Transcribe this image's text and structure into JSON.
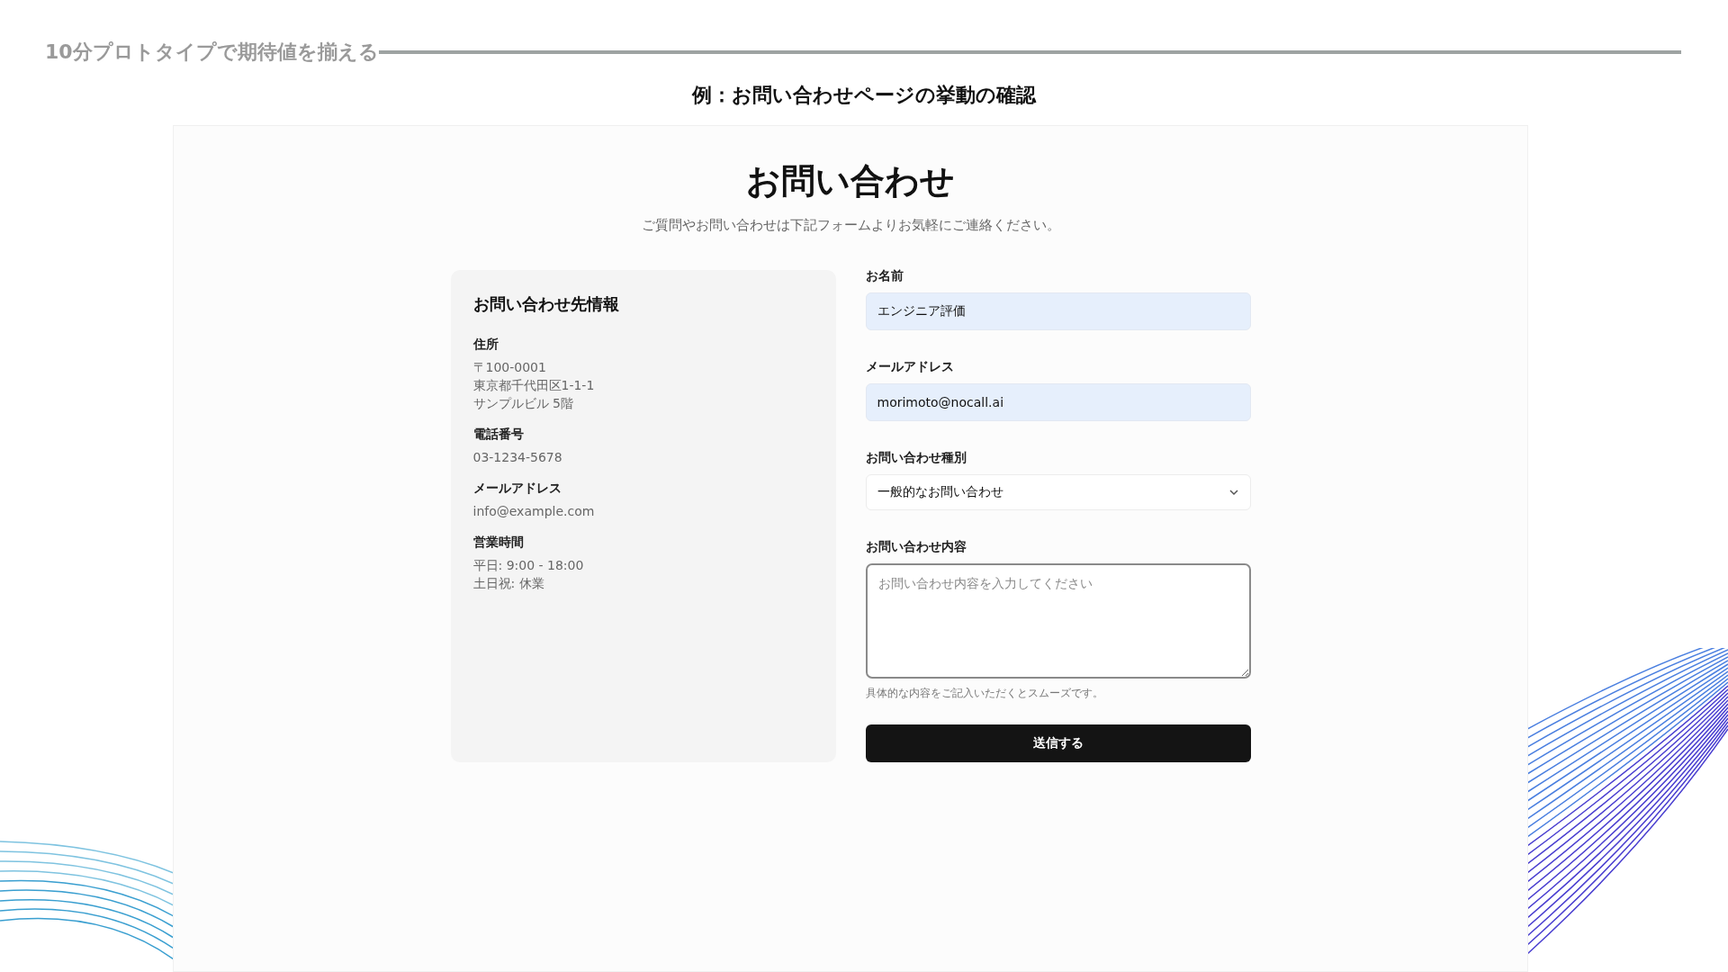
{
  "slide": {
    "heading": "10分プロトタイプで期待値を揃える",
    "caption": "例：お問い合わせページの挙動の確認"
  },
  "page": {
    "title": "お問い合わせ",
    "description": "ご質問やお問い合わせは下記フォームよりお気軽にご連絡ください。",
    "info_card": {
      "title": "お問い合わせ先情報",
      "sections": [
        {
          "label": "住所",
          "lines": [
            "〒100-0001",
            "東京都千代田区1-1-1",
            "サンプルビル 5階"
          ]
        },
        {
          "label": "電話番号",
          "lines": [
            "03-1234-5678"
          ]
        },
        {
          "label": "メールアドレス",
          "lines": [
            "info@example.com"
          ]
        },
        {
          "label": "営業時間",
          "lines": [
            "平日: 9:00 - 18:00",
            "土日祝: 休業"
          ]
        }
      ]
    },
    "form": {
      "fields": [
        {
          "kind": "input",
          "label": "お名前",
          "value": "エンジニア評価"
        },
        {
          "kind": "input",
          "label": "メールアドレス",
          "value": "morimoto@nocall.ai"
        },
        {
          "kind": "select",
          "label": "お問い合わせ種別",
          "value": "一般的なお問い合わせ"
        },
        {
          "kind": "textarea",
          "label": "お問い合わせ内容",
          "placeholder": "お問い合わせ内容を入力してください",
          "hint": "具体的な内容をご記入いただくとスムーズです。"
        }
      ],
      "submit": "送信する"
    }
  }
}
